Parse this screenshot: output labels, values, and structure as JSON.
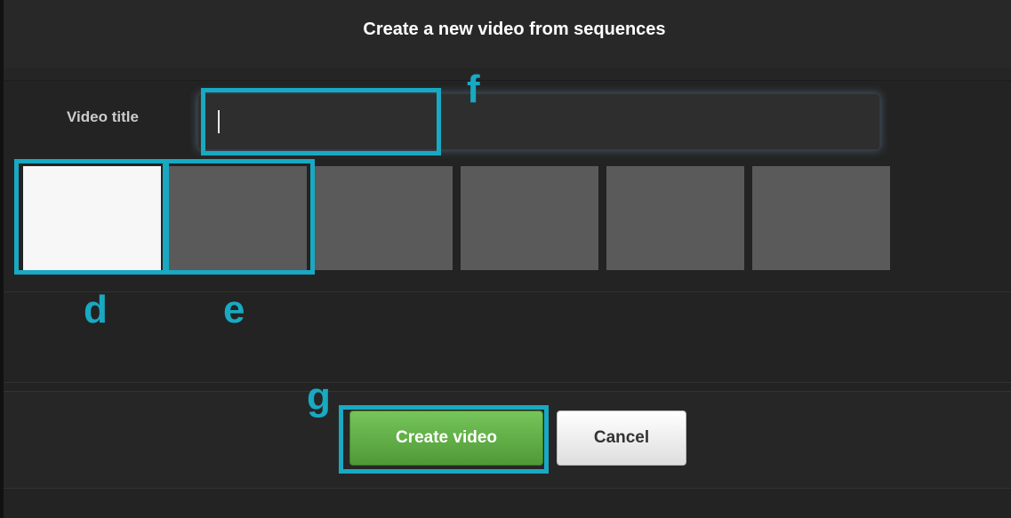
{
  "dialog": {
    "title": "Create a new video from sequences",
    "video_title_label": "Video title",
    "video_title_value": "",
    "thumbnails": [
      {
        "state": "blank"
      },
      {
        "state": "empty"
      },
      {
        "state": "empty"
      },
      {
        "state": "empty"
      },
      {
        "state": "empty"
      },
      {
        "state": "empty"
      }
    ],
    "create_label": "Create video",
    "cancel_label": "Cancel"
  },
  "annotations": {
    "d": "d",
    "e": "e",
    "f": "f",
    "g": "g"
  },
  "colors": {
    "highlight": "#19a9c2",
    "create_button": "#5fae45",
    "background": "#232323"
  }
}
